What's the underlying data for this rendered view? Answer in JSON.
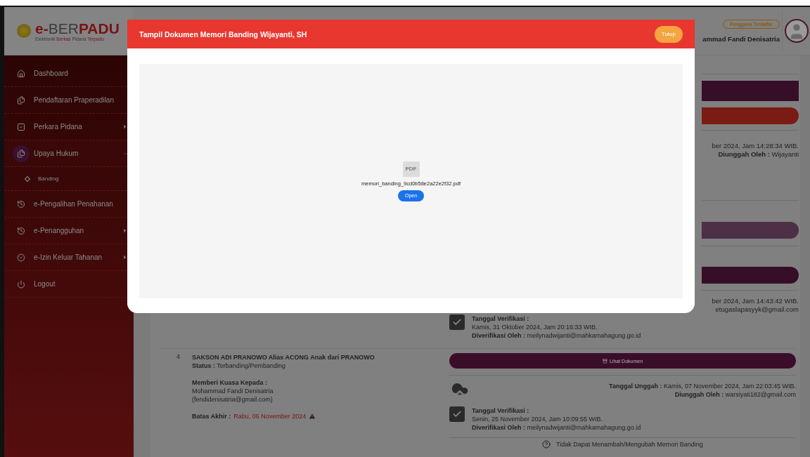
{
  "logo": {
    "title": [
      {
        "text": "e-",
        "accent": true
      },
      {
        "text": "BER",
        "accent": false
      },
      {
        "text": "PADU",
        "accent": true
      }
    ],
    "subtitle": [
      {
        "text": "Elektronik ",
        "accent": false
      },
      {
        "text": "Berkas ",
        "accent": true
      },
      {
        "text": "Pidana ",
        "accent": false
      },
      {
        "text": "Terpadu",
        "accent": true
      }
    ]
  },
  "header": {
    "user_badge": "Pengguna Terdaftar",
    "user_name": "ammad Fandi Denisatria"
  },
  "sidebar": {
    "items": [
      {
        "label": "Dashboard",
        "has_arrow": false,
        "selected": false
      },
      {
        "label": "Pendaftaran Praperadilan",
        "has_arrow": false,
        "selected": false
      },
      {
        "label": "Perkara Pidana",
        "has_arrow": true,
        "selected": false
      },
      {
        "label": "Upaya Hukum",
        "has_arrow": false,
        "selected": true,
        "expanded": true,
        "children": [
          {
            "label": "Banding"
          }
        ]
      },
      {
        "label": "e-Pengalihan Penahanan",
        "has_arrow": false,
        "selected": false
      },
      {
        "label": "e-Penangguhan",
        "has_arrow": true,
        "selected": false
      },
      {
        "label": "e-Izin Keluar Tahanan",
        "has_arrow": true,
        "selected": false
      },
      {
        "label": "Logout",
        "has_arrow": false,
        "selected": false
      }
    ]
  },
  "visible_strip": {
    "upload_tail": "ber 2024, Jam 14:28:34 WIB.",
    "uploader": "**Diunggah Oleh :** Wijayanti",
    "upload_tail_2": "ber 2024, Jam 14:43:42 WIB.",
    "uploader_2": "etugaslapasyyk@gmail.com"
  },
  "row_3_verification": {
    "label": "Tanggal Verifikasi :",
    "date": "Kamis, 31 Oktober 2024, Jam 20:16:33 WIB.",
    "by": "**Diverifikasi Oleh :** meilynadwijanti@mahkamahagung.go.id"
  },
  "row_4": {
    "number": "4",
    "name": "SAKSON ADI PRANOWO Alias ACONG Anak dari PRANOWO",
    "status": "**Status :** Terbanding/Pembanding",
    "proxy_label": "Memberi Kuasa Kepada :",
    "proxy_name": "Mohammad Fandi Denisatria",
    "proxy_email": "(fendidenisatria@gmail.com)",
    "deadline_label": "Batas Akhir :",
    "deadline": "Rabu, 06 November 2024",
    "view_button": "Lihat Dokumen",
    "upload_date": "**Tanggal Unggah :** Kamis, 07 November 2024, Jam 22:03:45 WIB.",
    "uploader": "**Diunggah Oleh :** warsiyati182@gmail.com",
    "verification_label": "Tanggal Verifikasi :",
    "verification_date": "Senin, 25 November 2024, Jam 10:09:55 WIB.",
    "verified_by": "**Diverifikasi Oleh :** meilynadwijanti@mahkamahagung.go.id",
    "notice": "Tidak Dapat Menambah/Mengubah Memori Banding"
  },
  "modal": {
    "title": "Tampil Dokumen Memori Banding Wijayanti, SH",
    "close_button": "Tutup",
    "file_badge": "PDF",
    "file_name": "memori_banding_9cd0b58e2a22e2f32.pdf",
    "open_button": "Open"
  }
}
